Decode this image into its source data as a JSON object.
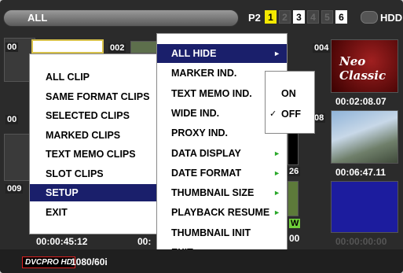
{
  "topbar": {
    "mode": "ALL",
    "media": "P2",
    "slots": [
      {
        "n": "1",
        "state": "active"
      },
      {
        "n": "2",
        "state": "empty"
      },
      {
        "n": "3",
        "state": "present"
      },
      {
        "n": "4",
        "state": "empty"
      },
      {
        "n": "5",
        "state": "empty"
      },
      {
        "n": "6",
        "state": "present"
      }
    ],
    "hdd": "HDD"
  },
  "thumbnails": {
    "numbers": [
      "00",
      "002",
      "004",
      "00",
      "08",
      "009",
      "26"
    ],
    "overlay_text": "Neo Classic",
    "badge_w": "W",
    "timecodes": {
      "tr1": "00:02:08.07",
      "tr2": "00:06:47.11",
      "tr3": "00:00:00:00",
      "bl": "00:00:45:12",
      "bm": "00:",
      "bm2": "00"
    }
  },
  "clip_menu": {
    "items": [
      {
        "label": "ALL CLIP",
        "selected": false
      },
      {
        "label": "SAME FORMAT CLIPS",
        "selected": false
      },
      {
        "label": "SELECTED CLIPS",
        "selected": false
      },
      {
        "label": "MARKED CLIPS",
        "selected": false
      },
      {
        "label": "TEXT MEMO CLIPS",
        "selected": false
      },
      {
        "label": "SLOT CLIPS",
        "selected": false
      },
      {
        "label": "SETUP",
        "selected": true
      },
      {
        "label": "EXIT",
        "selected": false
      }
    ]
  },
  "option_menu": {
    "items": [
      {
        "label": "ALL HIDE",
        "arrow": true,
        "selected": true
      },
      {
        "label": "MARKER IND.",
        "arrow": true,
        "selected": false
      },
      {
        "label": "TEXT MEMO IND.",
        "arrow": true,
        "selected": false
      },
      {
        "label": "WIDE IND.",
        "arrow": false,
        "selected": false
      },
      {
        "label": "PROXY IND.",
        "arrow": false,
        "selected": false
      },
      {
        "label": "DATA DISPLAY",
        "arrow": true,
        "selected": false
      },
      {
        "label": "DATE FORMAT",
        "arrow": true,
        "selected": false
      },
      {
        "label": "THUMBNAIL SIZE",
        "arrow": true,
        "selected": false
      },
      {
        "label": "PLAYBACK RESUME",
        "arrow": true,
        "selected": false
      },
      {
        "label": "THUMBNAIL INIT",
        "arrow": false,
        "selected": false
      },
      {
        "label": "EXIT",
        "arrow": false,
        "selected": false
      }
    ],
    "arrow_glyph": "►"
  },
  "sub_menu": {
    "items": [
      {
        "label": "ON",
        "checked": false
      },
      {
        "label": "OFF",
        "checked": true
      }
    ],
    "check_glyph": "✓"
  },
  "bottombar": {
    "badge": "DVCPRO HD",
    "format": "1080/60i"
  },
  "colors": {
    "selection": "#1a1f6b",
    "slot_active": "#f4e800",
    "arrow": "#2aa82a"
  }
}
